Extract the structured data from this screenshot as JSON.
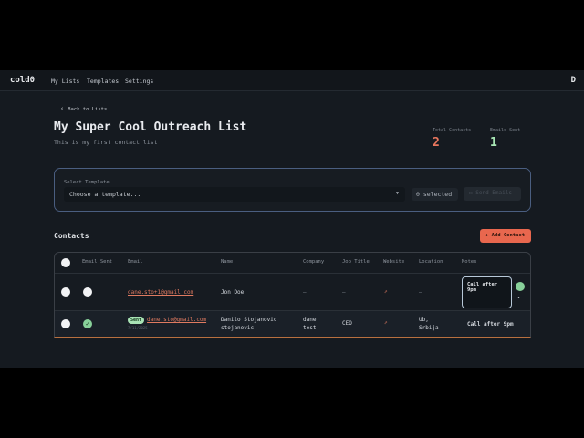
{
  "nav": {
    "brand": "cold0",
    "links": [
      "My Lists",
      "Templates",
      "Settings"
    ],
    "avatar": "D"
  },
  "page": {
    "back_label": "Back to Lists",
    "title": "My Super Cool Outreach List",
    "subtitle": "This is my first contact list"
  },
  "stats": {
    "total_label": "Total Contacts",
    "total_value": "2",
    "sent_label": "Emails Sent",
    "sent_value": "1",
    "total_color": "#e8765e",
    "sent_color": "#a8e6b4"
  },
  "template": {
    "label": "Select Template",
    "placeholder": "Choose a template...",
    "selected_count": "0 selected",
    "send_label": "Send Emails"
  },
  "contacts": {
    "title": "Contacts",
    "add_label": "+ Add Contact",
    "columns": [
      "Email Sent",
      "Email",
      "Name",
      "Company",
      "Job Title",
      "Website",
      "Location",
      "Notes"
    ],
    "rows": [
      {
        "email": "dane.sto+1@gmail.com",
        "name": "Jon Doe",
        "company": "–",
        "job_title": "–",
        "location": "–",
        "notes": "Call after 9pm",
        "sent": false
      },
      {
        "badge": "Sent",
        "email": "dane.sto@gmail.com",
        "date": "7/11/2025",
        "name_line1": "Danilo Stojanovic",
        "name_line2": "stojanovic",
        "company_line1": "dane",
        "company_line2": "test",
        "job_title": "CEO",
        "location_line1": "Ub,",
        "location_line2": "Srbija",
        "notes": "Call after 9pm",
        "sent": true
      }
    ]
  },
  "colors": {
    "accent": "#e8674e",
    "success": "#88d19a"
  }
}
